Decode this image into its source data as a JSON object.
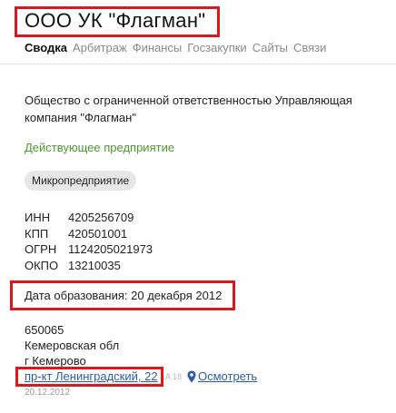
{
  "company": {
    "title": "ООО УК \"Флагман\"",
    "full_name": "Общество с ограниченной ответственностью Управляющая компания \"Флагман\"",
    "status": "Действующее предприятие",
    "size_badge": "Микропредприятие"
  },
  "tabs": [
    {
      "label": "Сводка",
      "active": true
    },
    {
      "label": "Арбитраж",
      "active": false
    },
    {
      "label": "Финансы",
      "active": false
    },
    {
      "label": "Госзакупки",
      "active": false
    },
    {
      "label": "Сайты",
      "active": false
    },
    {
      "label": "Связи",
      "active": false
    }
  ],
  "codes": [
    {
      "key": "ИНН",
      "value": "4205256709"
    },
    {
      "key": "КПП",
      "value": "420501001"
    },
    {
      "key": "ОГРН",
      "value": "1124205021973"
    },
    {
      "key": "ОКПО",
      "value": "13210035"
    }
  ],
  "founded": {
    "text": "Дата образования: 20 декабря 2012"
  },
  "address": {
    "postcode": "650065",
    "region": "Кемеровская обл",
    "city": "г Кемерово",
    "street": "пр-кт Ленинградский, 22",
    "street_suffix": "A 18",
    "map_label": "Осмотреть",
    "date": "20.12.2012",
    "map_icon": "map-pin-icon"
  },
  "colors": {
    "highlight": "#e0161b",
    "status_green": "#4c9a2a",
    "link": "#2a5db0",
    "tab_inactive": "#8a8a8a",
    "badge_bg": "#e7e7e7"
  }
}
